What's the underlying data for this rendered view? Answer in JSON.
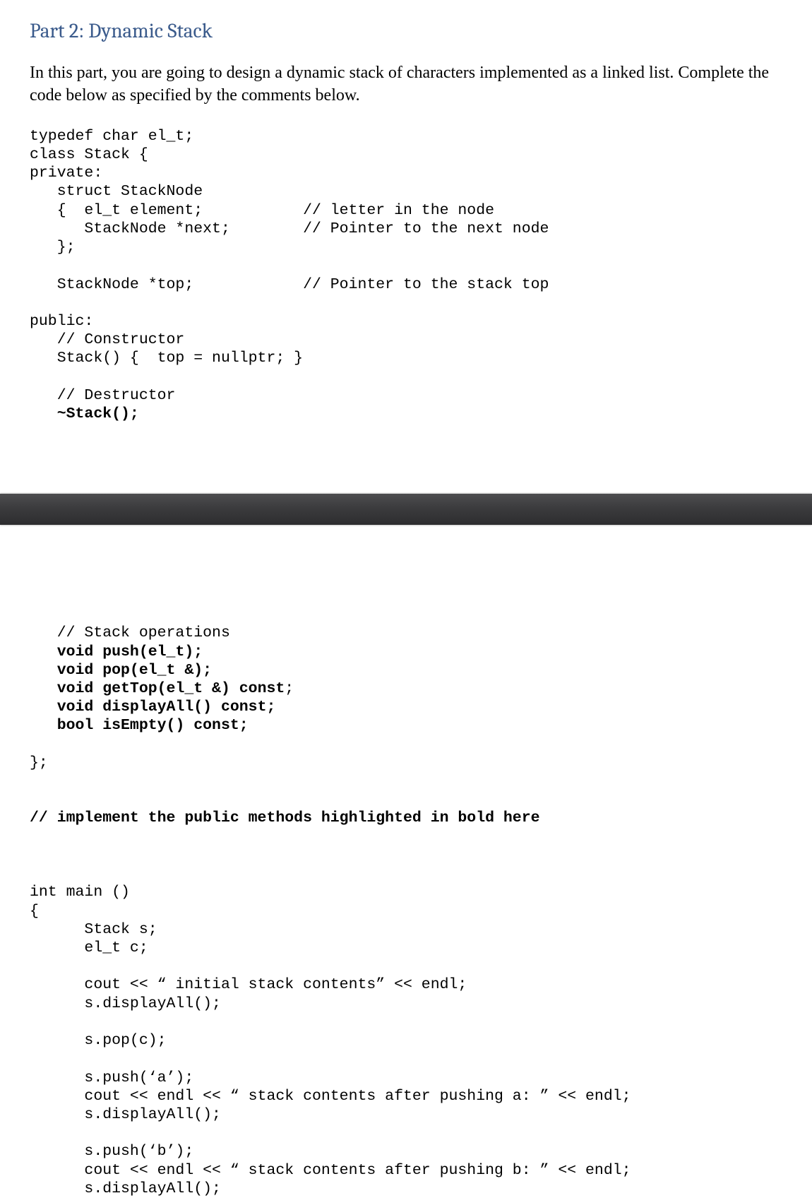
{
  "heading": "Part 2: Dynamic Stack",
  "instruction": "In this part, you are going to design a dynamic stack of characters implemented as a linked list. Complete the code below as specified by the comments below.",
  "code1": {
    "l1": "typedef char el_t;",
    "l2": "class Stack {",
    "l3": "private:",
    "l4": "   struct StackNode",
    "l5": "   {  el_t element;           // letter in the node",
    "l6": "      StackNode *next;        // Pointer to the next node",
    "l7": "   };",
    "l8": "",
    "l9": "   StackNode *top;            // Pointer to the stack top",
    "l10": "",
    "l11": "public:",
    "l12": "   // Constructor",
    "l13": "   Stack() {  top = nullptr; }",
    "l14": "",
    "l15": "   // Destructor",
    "l16_pre": "   ",
    "l16_bold": "~Stack();"
  },
  "code2": {
    "l1": "   // Stack operations",
    "l2_pre": "   ",
    "l2_bold": "void push(el_t);",
    "l3_pre": "   ",
    "l3_bold": "void pop(el_t &);",
    "l4_pre": "   ",
    "l4_bold": "void getTop(el_t &) const",
    "l4_post": ";",
    "l5_pre": "   ",
    "l5_bold": "void displayAll() const;",
    "l6_pre": "   ",
    "l6_bold": "bool isEmpty() const;",
    "l7": "",
    "l8": "};",
    "l9": "",
    "l10": "",
    "l11_bold": "// implement the public methods highlighted in bold here",
    "l12": "",
    "l13": "",
    "l14": "",
    "l15": "int main ()",
    "l16": "{",
    "l17": "      Stack s;",
    "l18": "      el_t c;",
    "l19": "",
    "l20": "      cout << “ initial stack contents” << endl;",
    "l21": "      s.displayAll();",
    "l22": "",
    "l23": "      s.pop(c);",
    "l24": "",
    "l25": "      s.push(‘a’);",
    "l26": "      cout << endl << “ stack contents after pushing a: ” << endl;",
    "l27": "      s.displayAll();",
    "l28": "",
    "l29": "      s.push(‘b’);",
    "l30": "      cout << endl << “ stack contents after pushing b: ” << endl;",
    "l31": "      s.displayAll();"
  }
}
